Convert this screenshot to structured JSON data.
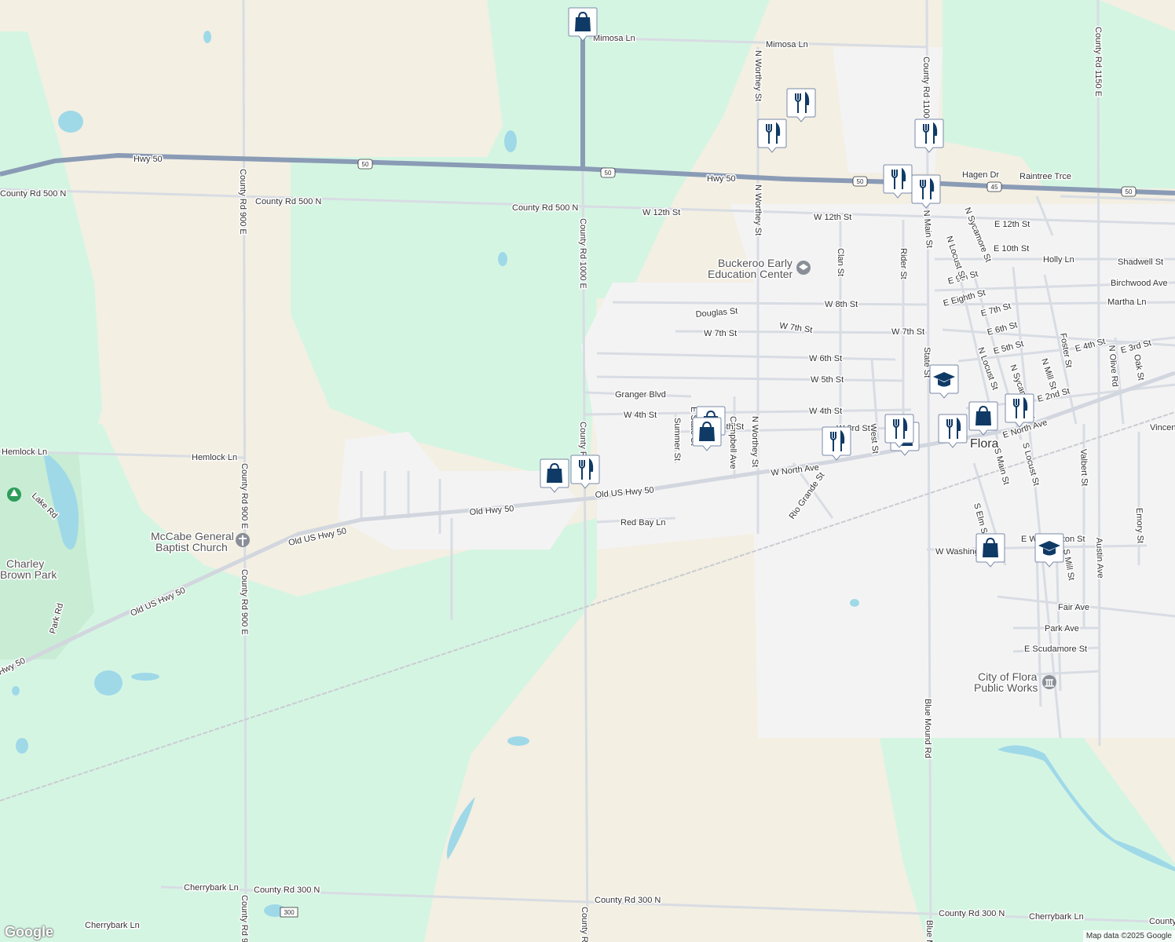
{
  "map": {
    "attribution": "Map data ©2025 Google",
    "logo": "Google",
    "town_label": "Flora",
    "colors": {
      "land": "#f3efe3",
      "forest": "#d5f5e3",
      "urban": "#f4f3f4",
      "park": "#c8ecd4",
      "water": "#9fd9e8",
      "highway": "#8a9bb5",
      "road": "#d8dce3",
      "marker": "#0f3a66"
    },
    "pois": [
      {
        "label": "Buckeroo Early Education Center",
        "line1": "Buckeroo Early",
        "line2": "Education Center",
        "icon": "school-icon"
      },
      {
        "label": "McCabe General Baptist Church",
        "line1": "McCabe General",
        "line2": "Baptist Church",
        "icon": "church-icon"
      },
      {
        "label": "Charley Brown Park",
        "line1": "Charley",
        "line2": "Brown Park",
        "icon": "tree-icon"
      },
      {
        "label": "City of Flora Public Works",
        "line1": "City of Flora",
        "line2": "Public Works",
        "icon": "government-icon"
      }
    ],
    "road_labels": [
      "Hwy 50",
      "County Rd 500 N",
      "Mimosa Ln",
      "County Rd 1000 E",
      "County Rd 900 E",
      "W 12th St",
      "Old Hwy 50",
      "Old US Hwy 50",
      "Hemlock Ln",
      "W North Ave",
      "Red Bay Ln",
      "Granger Blvd",
      "W 4th St",
      "W 5th St",
      "W 6th St",
      "W 7th St",
      "W 8th St",
      "Douglas St",
      "N Worthey St",
      "Clan St",
      "Rider St",
      "State St",
      "County Rd 1100 E",
      "E 12th St",
      "E 10th St",
      "Holly Ln",
      "Shadwell St",
      "Birchwood Ave",
      "Martha Ln",
      "E 9th St",
      "E Eighth St",
      "E 7th St",
      "E 6th St",
      "E 5th St",
      "E 4th St",
      "E 3rd St",
      "E 2nd St",
      "E North Ave",
      "Hagen Dr",
      "Raintree Trce",
      "County Rd 1150 E",
      "Foster St",
      "N Olive Rd",
      "Oak St",
      "Valbert St",
      "Emory St",
      "Austin Ave",
      "Fair Ave",
      "Park Ave",
      "E Scudamore St",
      "S Locust St",
      "S Main St",
      "S Elm St",
      "Rio Grande St",
      "Summer St",
      "Campbell Ave",
      "West St",
      "Blue Mound Rd",
      "County Rd 300 N",
      "Cherrybark Ln",
      "Lake Rd",
      "Park Rd",
      "N Sycamore St",
      "N Locust St",
      "N Main St",
      "N Mill St",
      "W Washington St",
      "E Washington St",
      "S Mill St",
      "Vincennes Ave",
      "W 3rd St",
      "E State St",
      "County Rd"
    ],
    "shields": [
      "50",
      "50",
      "50",
      "45",
      "50",
      "300"
    ],
    "markers": [
      {
        "type": "shopping",
        "icon": "shopping-bag-icon"
      },
      {
        "type": "restaurant",
        "icon": "fork-knife-icon"
      },
      {
        "type": "restaurant",
        "icon": "fork-knife-icon"
      },
      {
        "type": "restaurant",
        "icon": "fork-knife-icon"
      },
      {
        "type": "restaurant",
        "icon": "fork-knife-icon"
      },
      {
        "type": "restaurant",
        "icon": "fork-knife-icon"
      },
      {
        "type": "school",
        "icon": "school-icon"
      },
      {
        "type": "shopping",
        "icon": "shopping-bag-icon"
      },
      {
        "type": "restaurant",
        "icon": "fork-knife-icon"
      },
      {
        "type": "shopping",
        "icon": "shopping-bag-icon"
      },
      {
        "type": "shopping",
        "icon": "shopping-bag-icon"
      },
      {
        "type": "restaurant",
        "icon": "fork-knife-icon"
      },
      {
        "type": "shopping",
        "icon": "shopping-bag-icon"
      },
      {
        "type": "restaurant",
        "icon": "fork-knife-icon"
      },
      {
        "type": "restaurant",
        "icon": "fork-knife-icon"
      },
      {
        "type": "shopping",
        "icon": "shopping-bag-icon"
      },
      {
        "type": "school",
        "icon": "school-icon"
      },
      {
        "type": "shopping",
        "icon": "shopping-bag-icon"
      },
      {
        "type": "restaurant",
        "icon": "fork-knife-icon"
      }
    ]
  }
}
